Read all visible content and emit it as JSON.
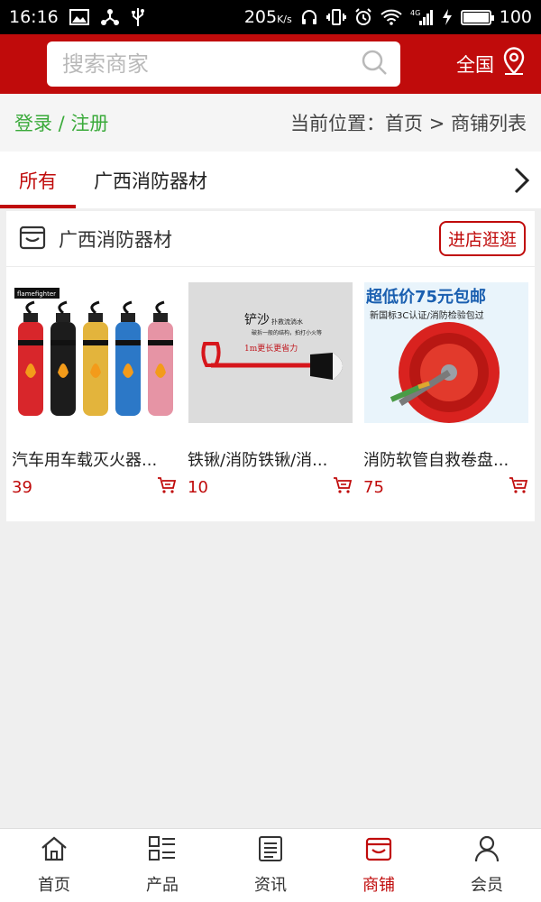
{
  "status_bar": {
    "time": "16:16",
    "speed": "205",
    "speed_unit": "K/s",
    "battery": "100",
    "left_icons": [
      "image-icon",
      "share-icon",
      "usb-icon"
    ],
    "right_icons": [
      "headset-icon",
      "vibrate-icon",
      "alarm-icon",
      "wifi-icon",
      "signal-4g-icon",
      "charging-icon",
      "battery-icon"
    ]
  },
  "header": {
    "search_placeholder": "搜索商家",
    "region_label": "全国",
    "accent_color": "#c00b0b"
  },
  "location_bar": {
    "login_label": "登录 / 注册",
    "breadcrumb": "当前位置：首页 > 商铺列表"
  },
  "tabs": {
    "items": [
      "所有",
      "广西消防器材"
    ],
    "active": "所有"
  },
  "shop": {
    "name": "广西消防器材",
    "enter_label": "进店逛逛",
    "products": [
      {
        "name": "汽车用车载灭火器...",
        "price": "39",
        "brand": "flamefighter"
      },
      {
        "name": "铁锹/消防铁锹/消...",
        "price": "10",
        "image_title": "铲沙",
        "image_sub": "扑救流淌水",
        "image_sub2": "破拆一般的结构，拍打小火等",
        "image_caption": "1m更长更省力"
      },
      {
        "name": "消防软管自救卷盘...",
        "price": "75",
        "image_title": "超低价75元包邮",
        "image_sub": "新国标3C认证/消防检验包过"
      }
    ]
  },
  "bottom_nav": {
    "items": [
      {
        "label": "首页",
        "icon": "home-icon"
      },
      {
        "label": "产品",
        "icon": "product-grid-icon"
      },
      {
        "label": "资讯",
        "icon": "news-icon"
      },
      {
        "label": "商铺",
        "icon": "store-icon"
      },
      {
        "label": "会员",
        "icon": "member-icon"
      }
    ],
    "active": "商铺"
  }
}
